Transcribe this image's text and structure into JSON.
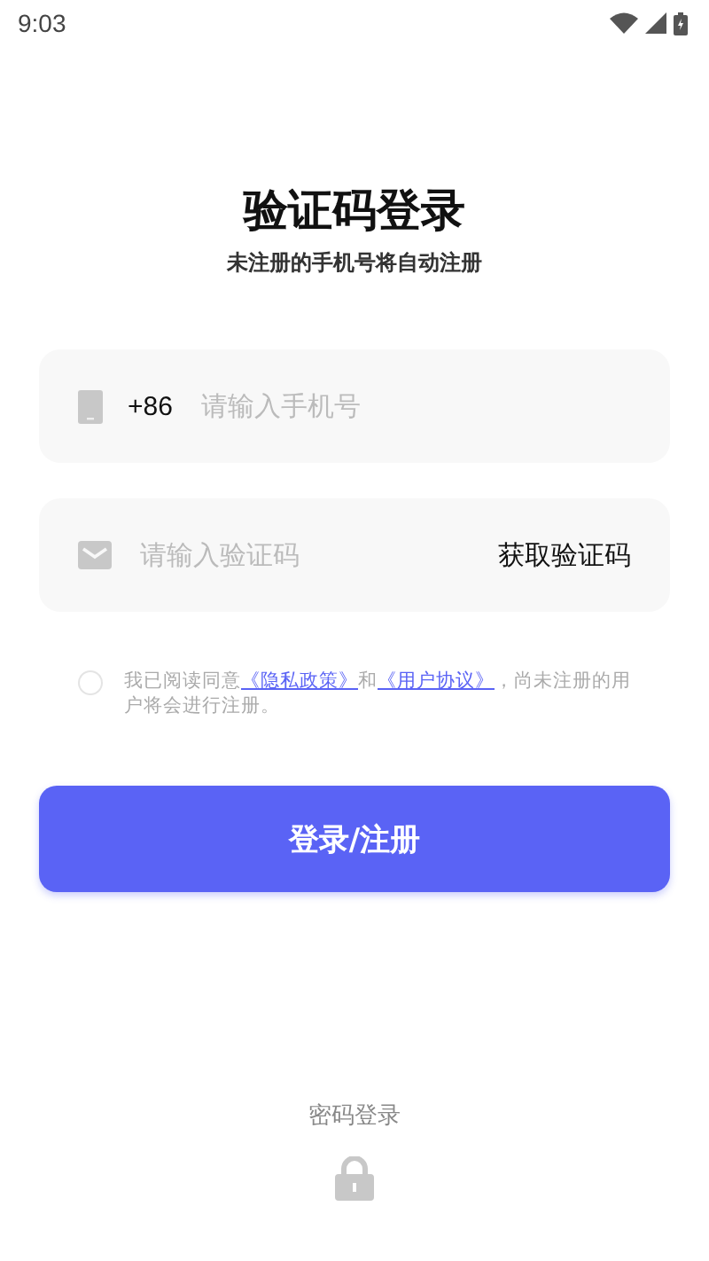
{
  "status_bar": {
    "time": "9:03"
  },
  "title": "验证码登录",
  "subtitle": "未注册的手机号将自动注册",
  "phone_field": {
    "prefix": "+86",
    "placeholder": "请输入手机号"
  },
  "code_field": {
    "placeholder": "请输入验证码",
    "action": "获取验证码"
  },
  "agreement": {
    "checked": false,
    "parts": [
      {
        "kind": "text",
        "text": "我已阅读同意"
      },
      {
        "kind": "link",
        "text": "《隐私政策》"
      },
      {
        "kind": "text",
        "text": "和"
      },
      {
        "kind": "link",
        "text": "《用户协议》"
      },
      {
        "kind": "text",
        "text": "，尚未注册的用户将会进行注册。"
      }
    ]
  },
  "submit_button": "登录/注册",
  "alt_login": {
    "label": "密码登录"
  }
}
